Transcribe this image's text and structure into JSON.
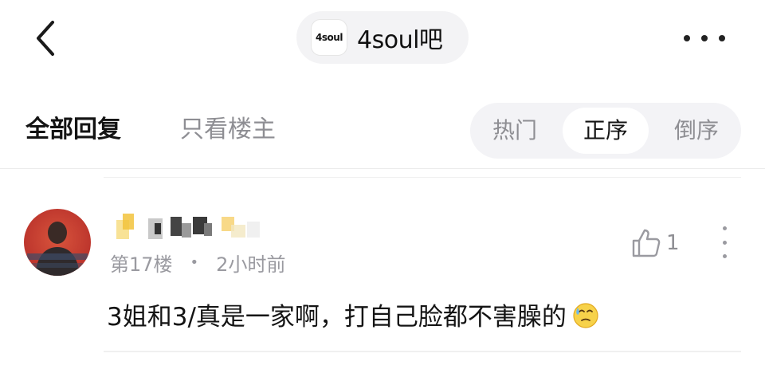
{
  "header": {
    "forum_logo_text": "4soul",
    "forum_name": "4soul吧"
  },
  "tabs": {
    "all_replies": "全部回复",
    "only_op": "只看楼主"
  },
  "sort": {
    "hot": "热门",
    "ascending": "正序",
    "descending": "倒序",
    "selected": "正序"
  },
  "reply": {
    "floor": "第17楼",
    "separator": "•",
    "time": "2小时前",
    "likes": "1",
    "text": "3姐和3/真是一家啊，打自己脸都不害臊的"
  },
  "icons": {
    "back": "chevron-left-icon",
    "more": "more-horizontal-icon",
    "like": "thumbs-up-icon",
    "reply_more": "more-vertical-icon",
    "emoji": "sweat-emoji-icon"
  }
}
